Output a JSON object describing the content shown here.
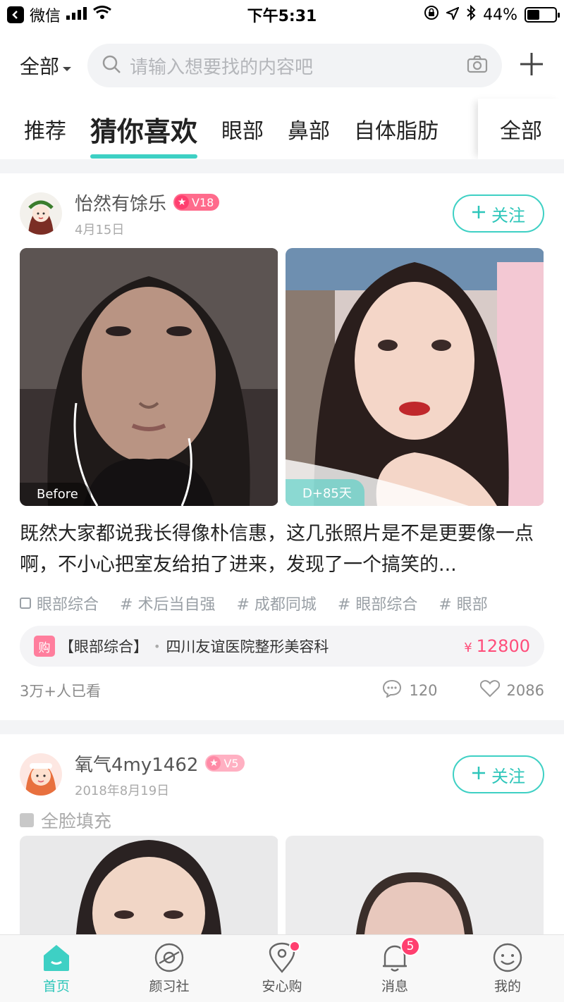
{
  "status_bar": {
    "back_app": "微信",
    "time": "下午5:31",
    "battery": "44%",
    "battery_level": 0.44
  },
  "header": {
    "scope_label": "全部",
    "search_placeholder": "请输入想要找的内容吧"
  },
  "tabs": {
    "items": [
      "推荐",
      "猜你喜欢",
      "眼部",
      "鼻部",
      "自体脂肪"
    ],
    "active_index": 1,
    "all_label": "全部"
  },
  "posts": [
    {
      "user": "怡然有馀乐",
      "level": "V18",
      "date": "4月15日",
      "follow_label": "关注",
      "photo_before": "Before",
      "photo_after": "D+85天",
      "text": "既然大家都说我长得像朴信惠，这几张照片是不是更要像一点啊，不小心把室友给拍了进来，发现了一个搞笑的...",
      "tags": [
        "眼部综合",
        "# 术后当自强",
        "# 成都同城",
        "# 眼部综合",
        "# 眼部"
      ],
      "shop": {
        "icon": "购",
        "title": "【眼部综合】",
        "hospital": "四川友谊医院整形美容科",
        "currency": "¥",
        "price": "12800"
      },
      "views": "3万+人已看",
      "comments": "120",
      "likes": "2086"
    },
    {
      "user": "氧气4my1462",
      "level": "V5",
      "date": "2018年8月19日",
      "follow_label": "关注",
      "category": "全脸填充"
    }
  ],
  "tabbar": {
    "items": [
      "首页",
      "颜习社",
      "安心购",
      "消息",
      "我的"
    ],
    "active_index": 0,
    "message_badge": "5"
  },
  "colors": {
    "accent": "#3ed0c4",
    "pink": "#ff4d7a",
    "badge": "#ff3f6f"
  }
}
